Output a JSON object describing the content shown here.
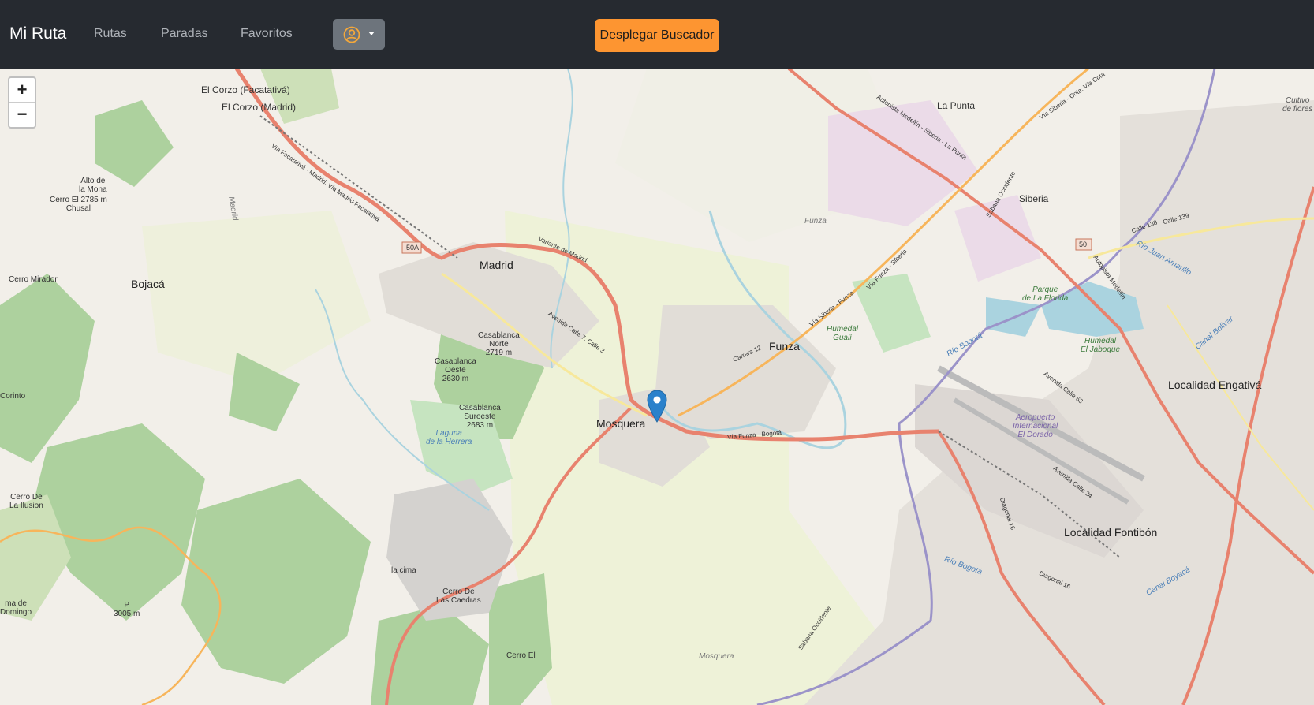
{
  "navbar": {
    "brand": "Mi Ruta",
    "links": [
      "Rutas",
      "Paradas",
      "Favoritos"
    ],
    "user_icon": "user-circle-icon",
    "search_button": "Desplegar Buscador"
  },
  "map": {
    "zoom_in": "+",
    "zoom_out": "−",
    "marker_icon": "map-pin-icon",
    "labels": {
      "el_corzo_facatativa": "El Corzo (Facatativá)",
      "el_corzo_madrid": "El Corzo (Madrid)",
      "la_punta": "La Punta",
      "madrid": "Madrid",
      "bojaca": "Bojacá",
      "funza": "Funza",
      "funza_small": "Funza",
      "mosquera": "Mosquera",
      "mosquera_bottom": "Mosquera",
      "siberia": "Siberia",
      "engativa": "Localidad Engativá",
      "fontibon": "Localidad Fontibón",
      "alto_mona": "Alto de\nla Mona",
      "cerro_chusal": "Cerro El 2785 m\nChusal",
      "cerro_mirador": "Cerro Mirador",
      "corinto": "Corinto",
      "cerro_ilusion": "Cerro De\nLa Ilusion",
      "domingo": "ma de\nDomingo",
      "p3005": "P\n3005 m",
      "la_cima": "la cima",
      "cerro_caedras": "Cerro De\nLas Caedras",
      "cerro_el": "Cerro El",
      "casablanca_norte": "Casablanca\nNorte\n2719 m",
      "casablanca_oeste": "Casablanca\nOeste\n2630 m",
      "casablanca_suroeste": "Casablanca\nSuroeste\n2683 m",
      "laguna_herrera": "Laguna\nde la Herrera",
      "humedal_guali": "Humedal\nGualí",
      "humedal_jaboque": "Humedal\nEl Jaboque",
      "parque_florida": "Parque\nde La Florida",
      "aeropuerto": "Aeropuerto\nInternacional\nEl Dorado",
      "cultivo_flores": "Cultivo\nde flores",
      "rio_bogota": "Río Bogotá",
      "rio_bogota_2": "Río Bogotá",
      "calle_138": "Calle 138",
      "calle_139": "Calle 139",
      "carrera_12": "Carrera 12",
      "variante_madrid": "Variante de Madrid",
      "via_funza_bogota": "Vía Funza - Bogotá",
      "avenida_calle_7": "Avenida Calle 7; Calle 3",
      "via_facatativa": "Vía Facatativá - Madrid; Vía Madrid-Facatativá",
      "autopista_medellin": "Autopista Medellín - Siberia - La Punta",
      "via_siberia_cota": "Vía Siberia - Cota; Vía Cota",
      "via_siberia_funza": "Vía Siberia - Funza",
      "via_funza_siberia": "Vía Funza - Siberia",
      "sabana_occidente": "Sabana Occidente",
      "sabana_occidente_2": "Sabana Occidente",
      "autopista_medellin_2": "Autopista Medellín",
      "avenida_calle_63": "Avenida Calle 63",
      "avenida_calle_24": "Avenida Calle 24",
      "diagonal_16": "Diagonal 16",
      "diagonal_16_b": "Diagonal 16",
      "canal_bolivar": "Canal Bolivar",
      "canal_boyaca": "Canal Boyacá",
      "rio_juan_amarillo": "Río Juan Amarillo",
      "madrid_river": "Madrid",
      "shield_50a": "50A",
      "shield_50": "50"
    }
  }
}
